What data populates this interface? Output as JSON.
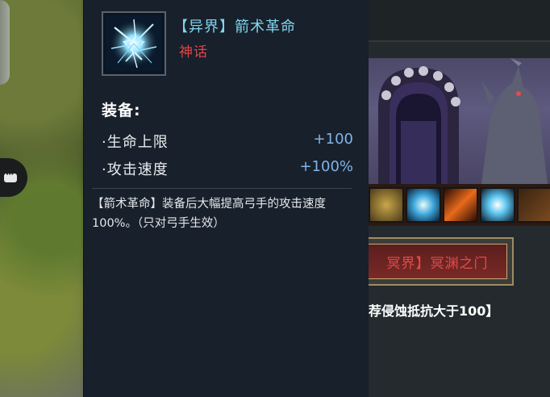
{
  "tooltip": {
    "item_name": "【异界】箭术革命",
    "rarity": "神话",
    "icon": "lightning-arrow-icon",
    "section_title": "装备:",
    "stats": [
      {
        "label": "·生命上限",
        "value": "+100"
      },
      {
        "label": "·攻击速度",
        "value": "+100%"
      }
    ],
    "description": "【箭术革命】装备后大幅提高弓手的攻击速度100%。（只对弓手生效）"
  },
  "scene": {
    "gate_title": "冥界】冥渊之门",
    "requirement": "荐侵蚀抵抗大于100】"
  },
  "colors": {
    "item_name": "#7fd6ee",
    "rarity": "#e34545",
    "stat_value": "#7fb4e8",
    "panel_bg": "#18202b"
  }
}
